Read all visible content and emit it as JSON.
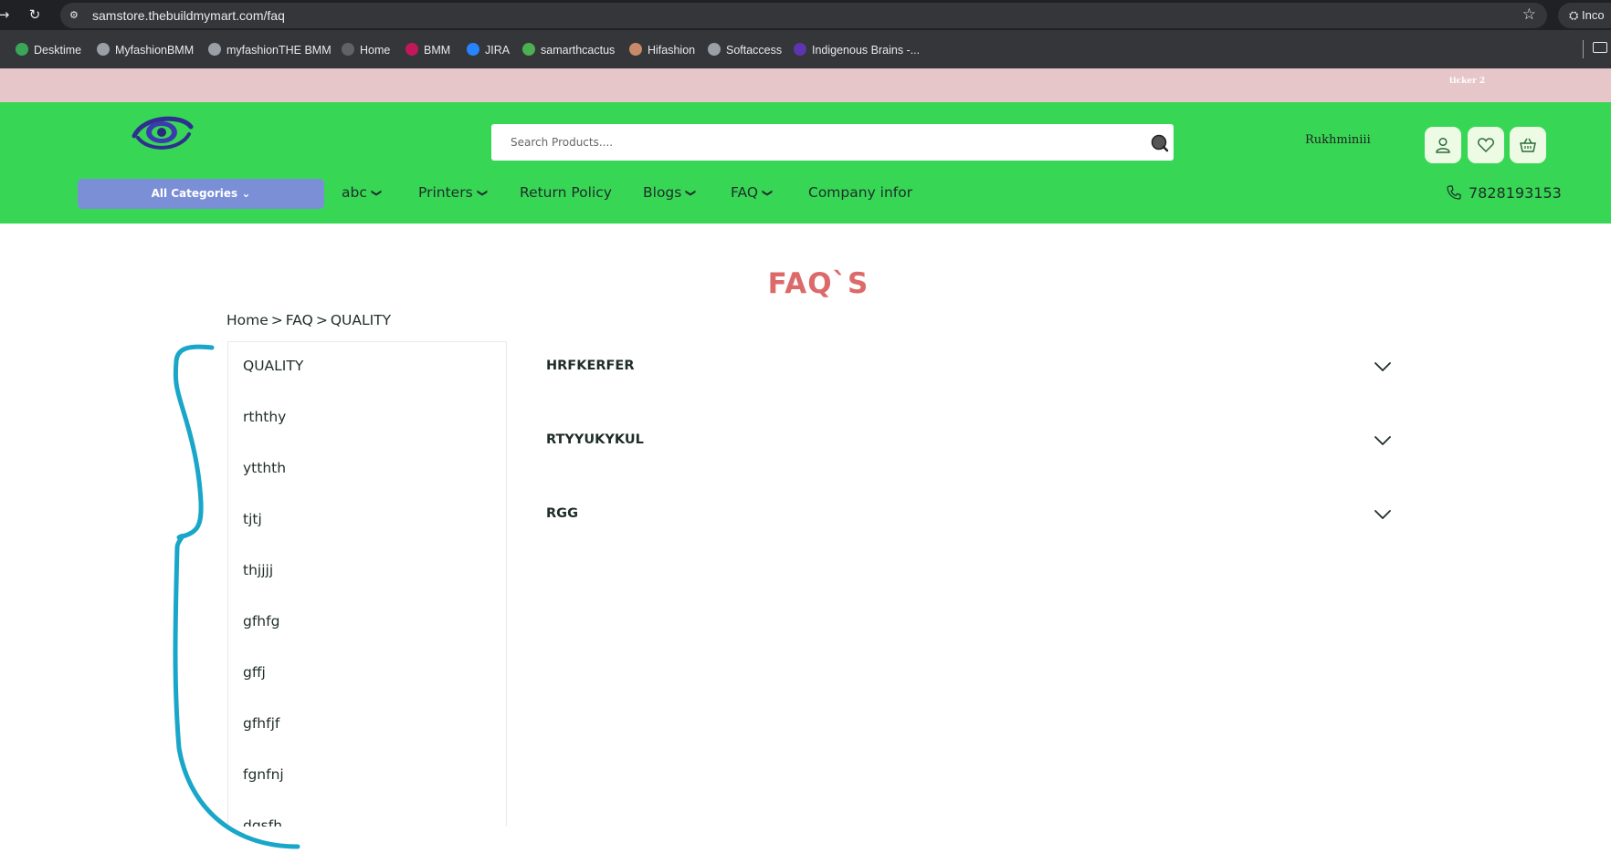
{
  "browser": {
    "url": "samstore.thebuildmymart.com/faq",
    "profile_label": "Inco",
    "bookmarks": [
      {
        "label": "Desktime",
        "color": "#3aa757"
      },
      {
        "label": "MyfashionBMM",
        "color": "#9aa0a6"
      },
      {
        "label": "myfashionTHE BMM",
        "color": "#9aa0a6"
      },
      {
        "label": "Home",
        "color": "#5f6368"
      },
      {
        "label": "BMM",
        "color": "#c2185b"
      },
      {
        "label": "JIRA",
        "color": "#2684ff"
      },
      {
        "label": "samarthcactus",
        "color": "#4caf50"
      },
      {
        "label": "Hifashion",
        "color": "#c98a6b"
      },
      {
        "label": "Softaccess",
        "color": "#9aa0a6"
      },
      {
        "label": "Indigenous Brains -...",
        "color": "#5e35b1"
      }
    ]
  },
  "ticker": {
    "text": "ticker 2"
  },
  "header": {
    "search_placeholder": "Search Products....",
    "user_name": "Rukhminiii",
    "all_categories": "All Categories",
    "menu": [
      {
        "label": "abc",
        "dropdown": true
      },
      {
        "label": "Printers",
        "dropdown": true
      },
      {
        "label": "Return Policy",
        "dropdown": false
      },
      {
        "label": "Blogs",
        "dropdown": true
      },
      {
        "label": "FAQ",
        "dropdown": true
      },
      {
        "label": "Company infor",
        "dropdown": false
      }
    ],
    "phone": "7828193153",
    "colors": {
      "header_bg": "#37d755",
      "ticker_bg": "#e6c6c9",
      "category_btn": "#7b8fd7",
      "title": "#dc6a6a"
    }
  },
  "page": {
    "title": "FAQ`S",
    "breadcrumb": [
      "Home",
      ">",
      "FAQ",
      ">",
      "QUALITY"
    ]
  },
  "sidebar": {
    "items": [
      "QUALITY",
      "rththy",
      "ytthth",
      "tjtj",
      "thjjjj",
      "gfhfg",
      "gffj",
      "gfhfjf",
      "fgnfnj",
      "dgsfh"
    ]
  },
  "faqs": [
    {
      "question": "HRFKERFER"
    },
    {
      "question": "RTYYUKYKUL"
    },
    {
      "question": "RGG"
    }
  ]
}
